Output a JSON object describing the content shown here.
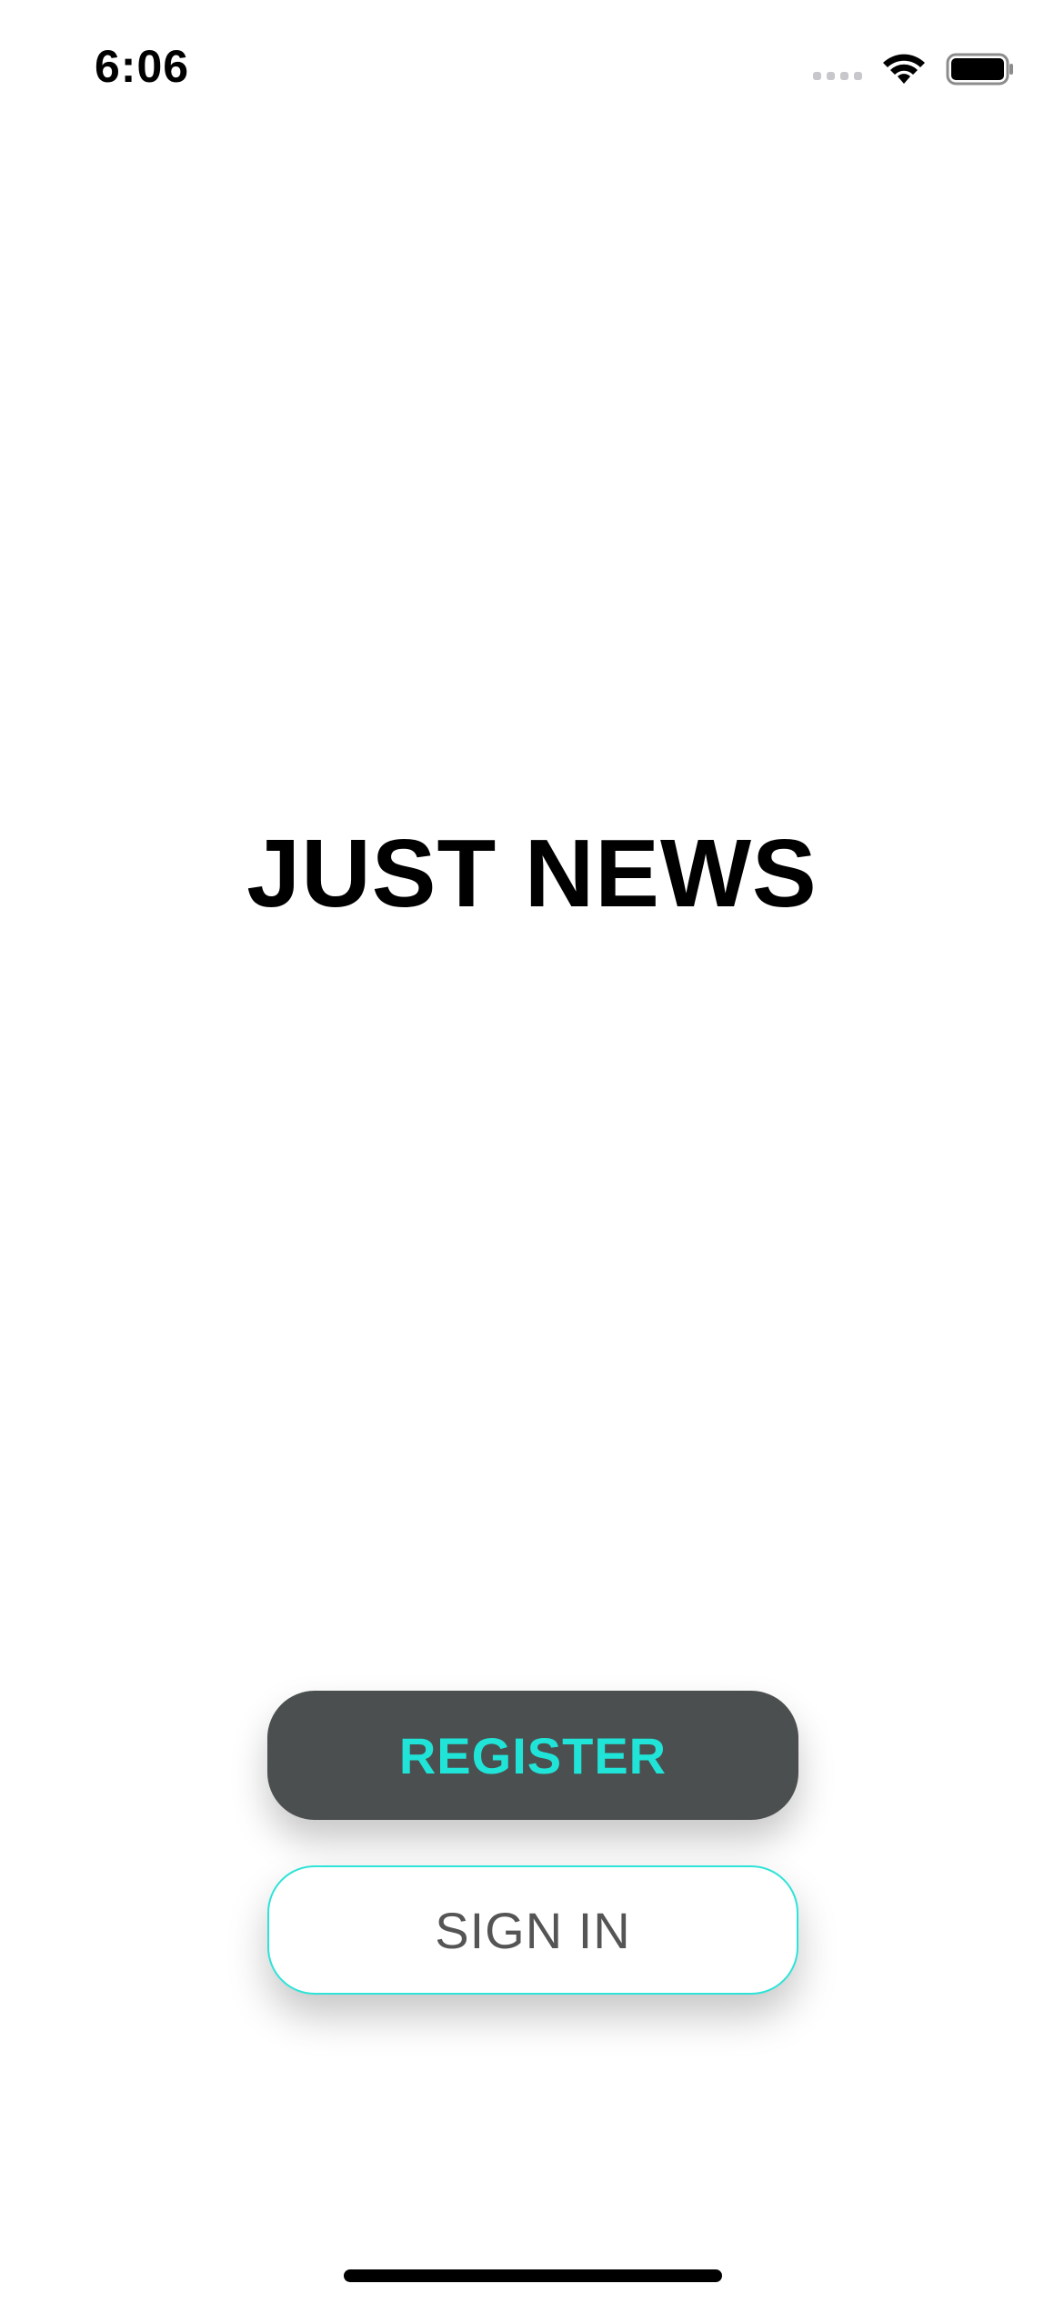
{
  "status_bar": {
    "time": "6:06",
    "icons": [
      "cellular-signal-icon",
      "wifi-icon",
      "battery-icon"
    ]
  },
  "app": {
    "title": "JUST NEWS"
  },
  "buttons": {
    "register_label": "REGISTER",
    "signin_label": "SIGN IN"
  },
  "colors": {
    "accent": "#20e4d8",
    "register_background": "#4b4f4f",
    "signin_border": "#2ee3d7",
    "signin_text": "#555555",
    "title_text": "#000000",
    "background": "#ffffff"
  }
}
